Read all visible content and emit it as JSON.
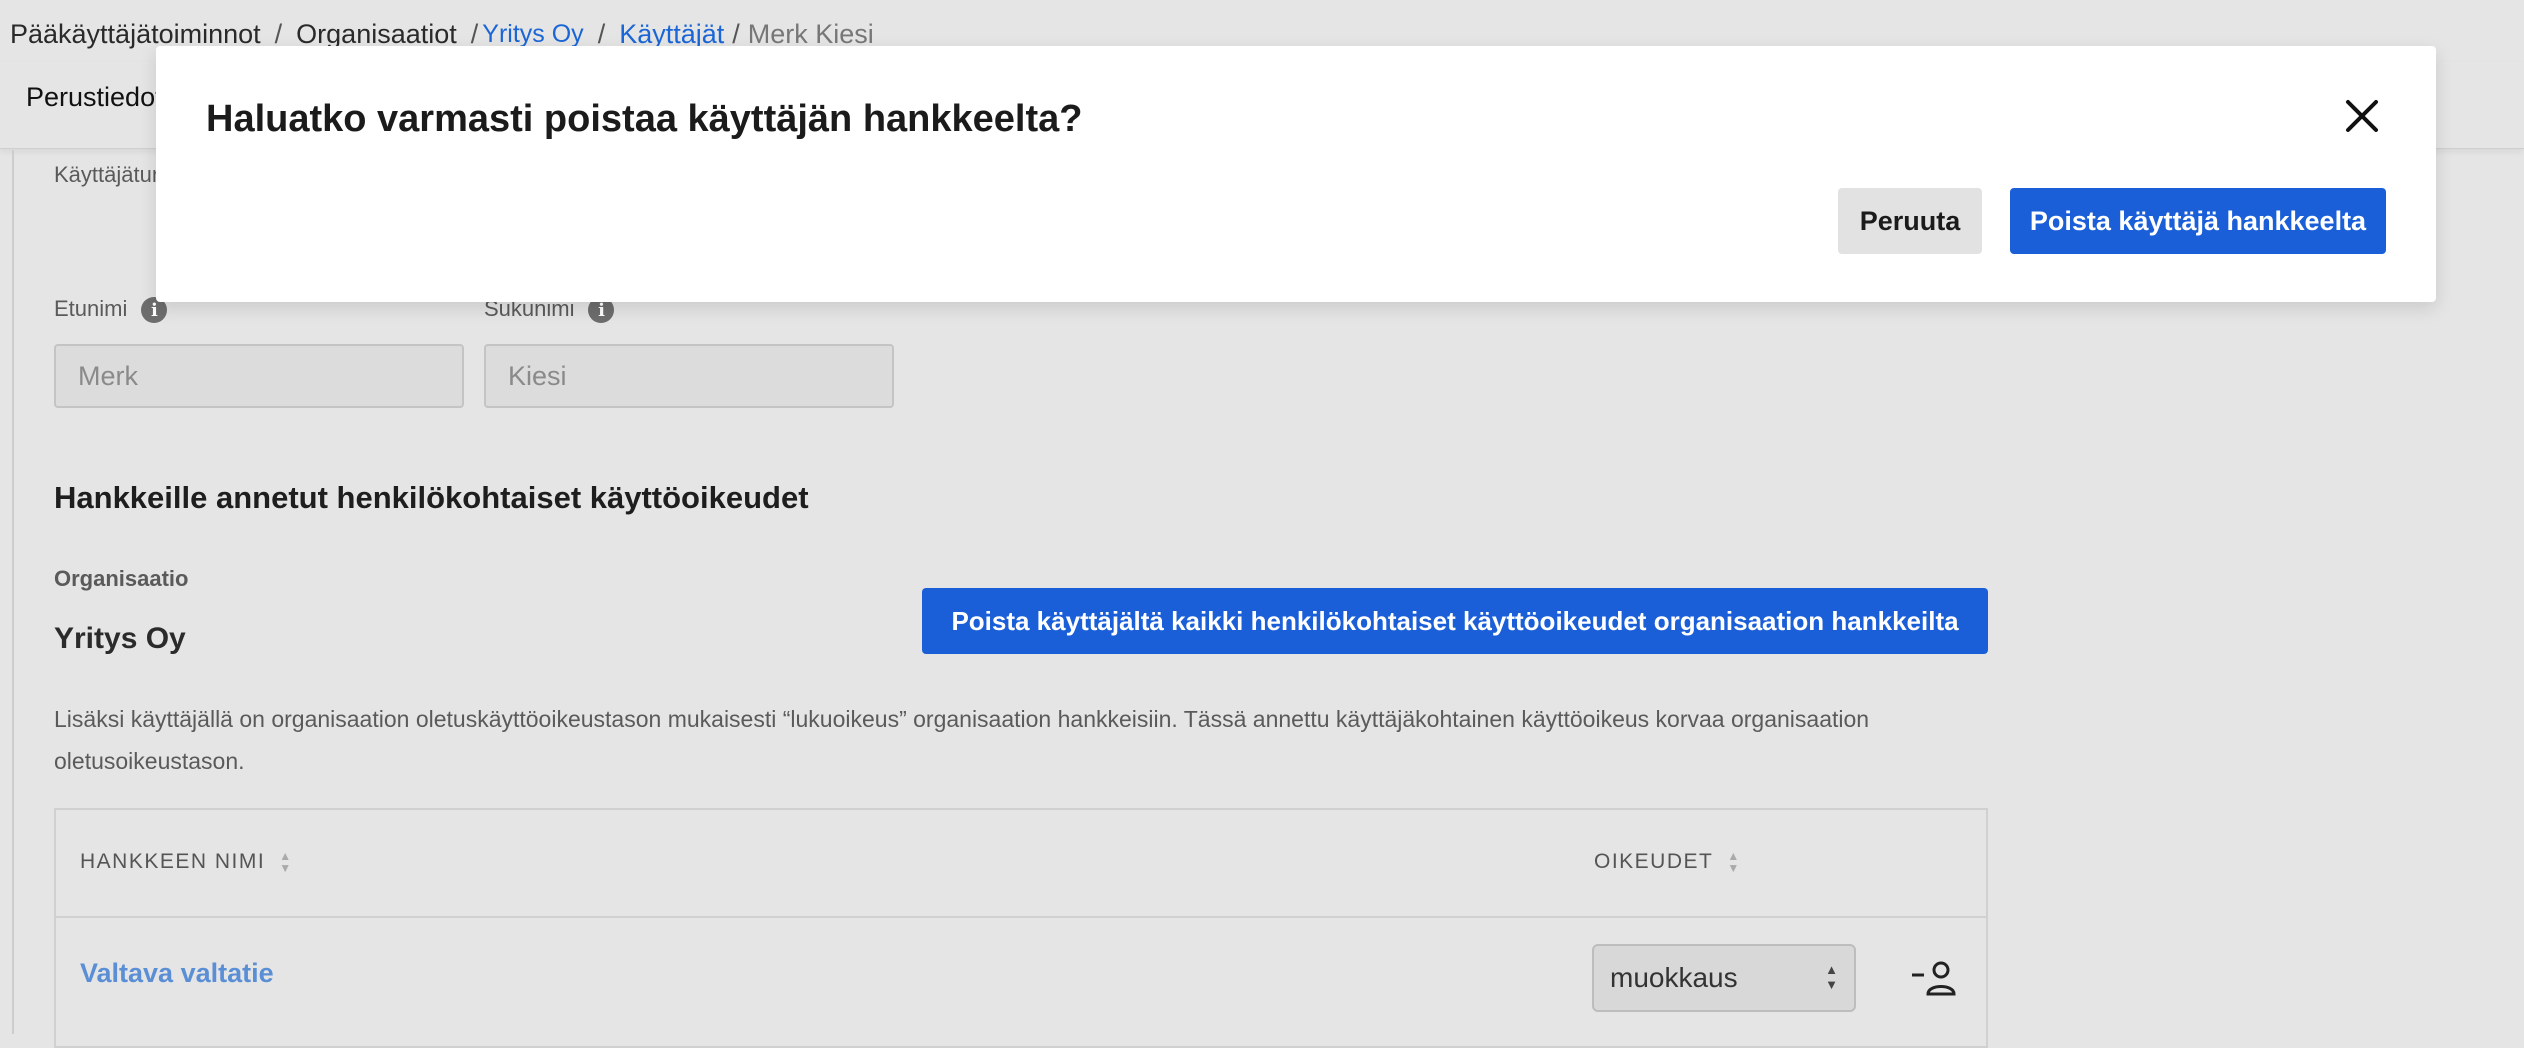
{
  "breadcrumb": {
    "items": [
      "Pääkäyttäjätoiminnot",
      "Organisaatiot",
      "Yritys Oy",
      "Käyttäjät",
      "Merk Kiesi"
    ],
    "separator": "/"
  },
  "header": {
    "tab_label": "Perustiedot"
  },
  "form": {
    "user_section_label": "Käyttäjätunnus",
    "first_name_label": "Etunimi",
    "last_name_label": "Sukunimi",
    "first_name_value": "Merk",
    "last_name_value": "Kiesi",
    "info_glyph": "i"
  },
  "projects": {
    "title": "Hankkeille annetut henkilökohtaiset käyttöoikeudet",
    "org_label": "Organisaatio",
    "org_name": "Yritys Oy",
    "remove_all_label": "Poista käyttäjältä kaikki henkilökohtaiset käyttöoikeudet organisaation hankkeilta",
    "note_line1": "Lisäksi käyttäjällä on organisaation oletuskäyttöoikeustason mukaisesti “lukuoikeus” organisaation hankkeisiin. Tässä annettu käyttäjäkohtainen käyttöoikeus korvaa organisaation",
    "note_line2": "oletusoikeustason.",
    "table": {
      "columns": [
        "HANKKEEN NIMI",
        "OIKEUDET"
      ],
      "rows": [
        {
          "name": "Valtava valtatie",
          "permission": "muokkaus",
          "action_icon": "remove-user-icon"
        }
      ]
    }
  },
  "modal": {
    "title": "Haluatko varmasti poistaa käyttäjän hankkeelta?",
    "cancel_label": "Peruuta",
    "confirm_label": "Poista käyttäjä hankkeelta",
    "close_icon": "close-icon"
  },
  "colors": {
    "accent": "#1a5fd8",
    "link": "#1a66d6",
    "backdrop": "#e5e5e5"
  }
}
